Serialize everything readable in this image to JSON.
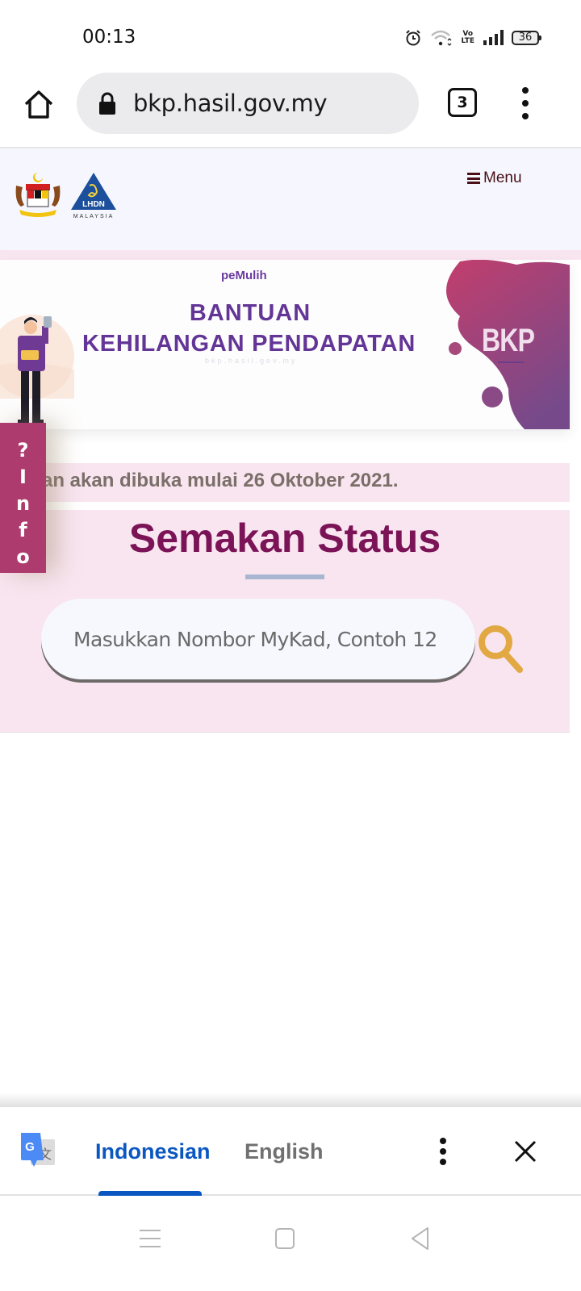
{
  "status_bar": {
    "time": "00:13",
    "icons": [
      "alarm-icon",
      "wifi-icon",
      "volte-icon",
      "signal-icon",
      "battery-icon"
    ],
    "volte_label_top": "Vo",
    "volte_label_bottom": "LTE",
    "battery_level": "36"
  },
  "browser": {
    "url": "bkp.hasil.gov.my",
    "tab_count": "3",
    "icons": {
      "home": "home-icon",
      "lock": "lock-icon",
      "more": "more-vert-icon"
    }
  },
  "site_header": {
    "logos": [
      "malaysia-coat-of-arms-logo",
      "lhdn-malaysia-logo"
    ],
    "lhdn_label": "LHDN",
    "lhdn_sublabel": "MALAYSIA",
    "menu_label": "Menu"
  },
  "banner": {
    "brand": "peMulih",
    "title_line1": "BANTUAN",
    "title_line2": "KEHILANGAN PENDAPATAN",
    "subtitle": "bkp.hasil.gov.my",
    "badge": "BKP"
  },
  "notice": {
    "text": "an akan dibuka mulai 26 Oktober 2021."
  },
  "info_tab": {
    "chars": [
      "?",
      "I",
      "n",
      "f",
      "o"
    ]
  },
  "status_check": {
    "title": "Semakan Status",
    "search_placeholder": "Masukkan Nombor MyKad, Contoh 12",
    "search_value": ""
  },
  "translate_bar": {
    "languages": [
      {
        "label": "Indonesian",
        "selected": true
      },
      {
        "label": "English",
        "selected": false
      }
    ]
  },
  "colors": {
    "accent_purple": "#633596",
    "title_magenta": "#7b1457",
    "info_tab": "#ad3b6e",
    "section_pink": "#f9e5f0",
    "search_gold": "#e2a843",
    "translate_blue": "#0b57c2"
  }
}
